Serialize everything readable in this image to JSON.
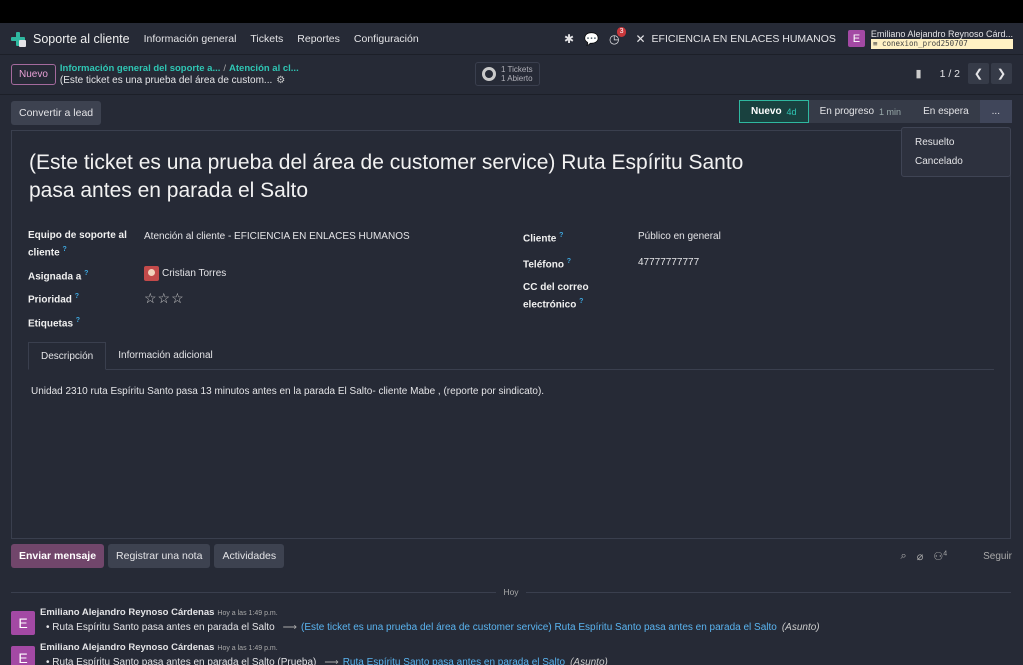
{
  "navbar": {
    "app_name": "Soporte al cliente",
    "menu": [
      "Información general",
      "Tickets",
      "Reportes",
      "Configuración"
    ],
    "activity_count": "3",
    "company": "EFICIENCIA EN ENLACES HUMANOS",
    "user_initial": "E",
    "user_name": "Emiliano Alejandro Reynoso Cárd...",
    "database": "conexion_prod250707"
  },
  "control": {
    "new_label": "Nuevo",
    "breadcrumb_1": "Información general del soporte a...",
    "breadcrumb_2": "Atención al cl...",
    "record_name": "(Este ticket es una prueba del área de custom...",
    "tickets_count": "1 Tickets",
    "open_count": "1 Abierto",
    "pager": "1 / 2"
  },
  "statusbar": {
    "convert_label": "Convertir a lead",
    "stages": [
      {
        "label": "Nuevo",
        "duration": "4d"
      },
      {
        "label": "En progreso",
        "duration": "1 min"
      },
      {
        "label": "En espera",
        "duration": ""
      }
    ],
    "more_label": "...",
    "dropdown": [
      "Resuelto",
      "Cancelado"
    ]
  },
  "form": {
    "title": "(Este ticket es una prueba del área de customer service) Ruta Espíritu Santo pasa antes en parada el Salto",
    "team_label_1": "Equipo de soporte al",
    "team_label_2": "cliente",
    "team_value": "Atención al cliente - EFICIENCIA EN ENLACES HUMANOS",
    "assigned_label": "Asignada a",
    "assigned_value": "Cristian Torres",
    "priority_label": "Prioridad",
    "priority_stars": "☆☆☆",
    "tags_label": "Etiquetas",
    "customer_label": "Cliente",
    "customer_value": "Público en general",
    "phone_label": "Teléfono",
    "phone_value": "47777777777",
    "cc_label_1": "CC del correo",
    "cc_label_2": "electrónico",
    "tabs": [
      "Descripción",
      "Información adicional"
    ],
    "description": "Unidad 2310 ruta Espíritu Santo pasa 13 minutos antes en la parada El Salto- cliente Mabe , (reporte por sindicato)."
  },
  "chatter": {
    "send_label": "Enviar mensaje",
    "note_label": "Registrar una nota",
    "activities_label": "Actividades",
    "followers_count": "4",
    "follow_label": "Seguir",
    "today_label": "Hoy",
    "messages": [
      {
        "initial": "E",
        "author": "Emiliano Alejandro Reynoso Cárdenas",
        "time": "Hoy a las 1:49 p.m.",
        "old": "Ruta Espíritu Santo pasa antes en parada el Salto",
        "new": "(Este ticket es una prueba del área de customer service) Ruta Espíritu Santo pasa antes en parada el Salto",
        "field": "(Asunto)"
      },
      {
        "initial": "E",
        "author": "Emiliano Alejandro Reynoso Cárdenas",
        "time": "Hoy a las 1:49 p.m.",
        "old": "Ruta Espíritu Santo pasa antes en parada el Salto (Prueba)",
        "new": "Ruta Espíritu Santo pasa antes en parada el Salto",
        "field": "(Asunto)"
      }
    ]
  },
  "colors": {
    "accent": "#2fb8a0",
    "primary": "#71466b",
    "background": "#262a36",
    "user_avatar": "#a349a4"
  }
}
